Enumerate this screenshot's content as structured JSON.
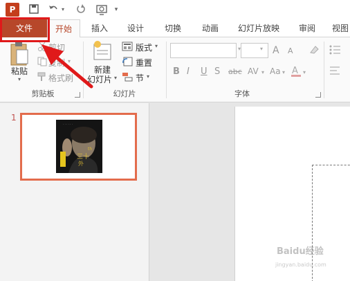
{
  "quick_access": {
    "app_icon": "powerpoint-icon",
    "icons": [
      "save-icon",
      "undo-icon",
      "undo-dropdown-icon",
      "redo-icon",
      "start-from-beginning-icon",
      "customize-qat-icon"
    ]
  },
  "tabs": {
    "file": "文件",
    "home": "开始",
    "insert": "插入",
    "design": "设计",
    "transitions": "切换",
    "animations": "动画",
    "slideshow": "幻灯片放映",
    "review": "审阅",
    "view": "视图"
  },
  "clipboard": {
    "paste": "粘贴",
    "cut": "剪切",
    "copy": "复制",
    "format_painter": "格式刷",
    "group_label": "剪贴板"
  },
  "slides": {
    "new_slide_line1": "新建",
    "new_slide_line2": "幻灯片",
    "layout": "版式",
    "reset": "重置",
    "section": "节",
    "group_label": "幻灯片"
  },
  "font": {
    "group_label": "字体",
    "bold": "B",
    "italic": "I",
    "underline": "U",
    "shadow": "S",
    "strike": "abc",
    "spacing": "AV",
    "case": "Aa",
    "grow": "A",
    "shrink": "A"
  },
  "thumbnail": {
    "number": "1"
  },
  "watermark": {
    "line1": "Baidu经验",
    "line2": "jingyan.baidu.com"
  },
  "colors": {
    "accent": "#b7472a",
    "highlight": "#e0191a",
    "thumb_border": "#e36c4c"
  }
}
